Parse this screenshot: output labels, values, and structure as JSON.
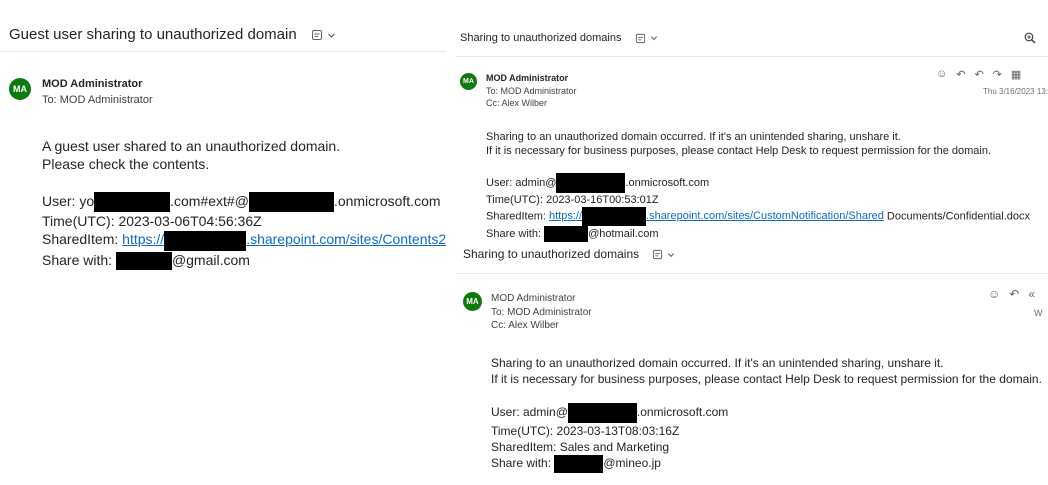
{
  "left_email": {
    "subject": "Guest user sharing to unauthorized domain",
    "avatar_initials": "MA",
    "sender": "MOD Administrator",
    "to": "To: MOD Administrator",
    "body_line1": "A guest user shared to an unauthorized domain.",
    "body_line2": "Please check the contents.",
    "user_prefix": "User: yo",
    "user_mid": ".com#ext#@",
    "user_suffix": ".onmicrosoft.com",
    "time": "Time(UTC): 2023-03-06T04:56:36Z",
    "shared_prefix": "SharedItem: ",
    "shared_link_start": "https://",
    "shared_link_end": ".sharepoint.com/sites/Contents2",
    "share_with_prefix": "Share with: ",
    "share_with_suffix": "@gmail.com"
  },
  "right_email_1": {
    "subject": "Sharing to unauthorized domains",
    "avatar_initials": "MA",
    "sender": "MOD Administrator",
    "to": "To: MOD Administrator",
    "cc": "Cc: Alex Wilber",
    "date": "Thu 3/16/2023 13:",
    "body_line1": "Sharing to an unauthorized domain occurred. If it's an unintended sharing, unshare it.",
    "body_line2": "If it is necessary for business purposes, please contact Help Desk to request permission for the domain.",
    "user_prefix": "User: admin@",
    "user_suffix": ".onmicrosoft.com",
    "time": "Time(UTC): 2023-03-16T00:53:01Z",
    "shared_prefix": "SharedItem: ",
    "shared_link_start": "https://",
    "shared_link_end": ".sharepoint.com/sites/CustomNotification/Shared",
    "shared_suffix": " Documents/Confidential.docx",
    "share_with_prefix": "Share with: ",
    "share_with_suffix": "@hotmail.com"
  },
  "right_email_2": {
    "subject": "Sharing to unauthorized domains",
    "avatar_initials": "MA",
    "sender": "MOD Administrator",
    "to": "To: MOD Administrator",
    "cc": "Cc: Alex Wilber",
    "date": "W",
    "body_line1": "Sharing to an unauthorized domain occurred. If it's an unintended sharing, unshare it.",
    "body_line2": "If it is necessary for business purposes, please contact Help Desk to request permission for the domain.",
    "user_prefix": "User: admin@",
    "user_suffix": ".onmicrosoft.com",
    "time": "Time(UTC): 2023-03-13T08:03:16Z",
    "shared_item": "SharedItem: Sales and Marketing",
    "share_with_prefix": "Share with: ",
    "share_with_suffix": "@mineo.jp"
  },
  "icons": {
    "subject_icon": "summary-icon",
    "chevron": "chevron-down-icon",
    "emoji": "emoji-icon",
    "reply": "reply-icon",
    "reply_all": "reply-all-icon",
    "forward": "forward-icon",
    "apps": "apps-icon",
    "zoom": "zoom-icon"
  }
}
